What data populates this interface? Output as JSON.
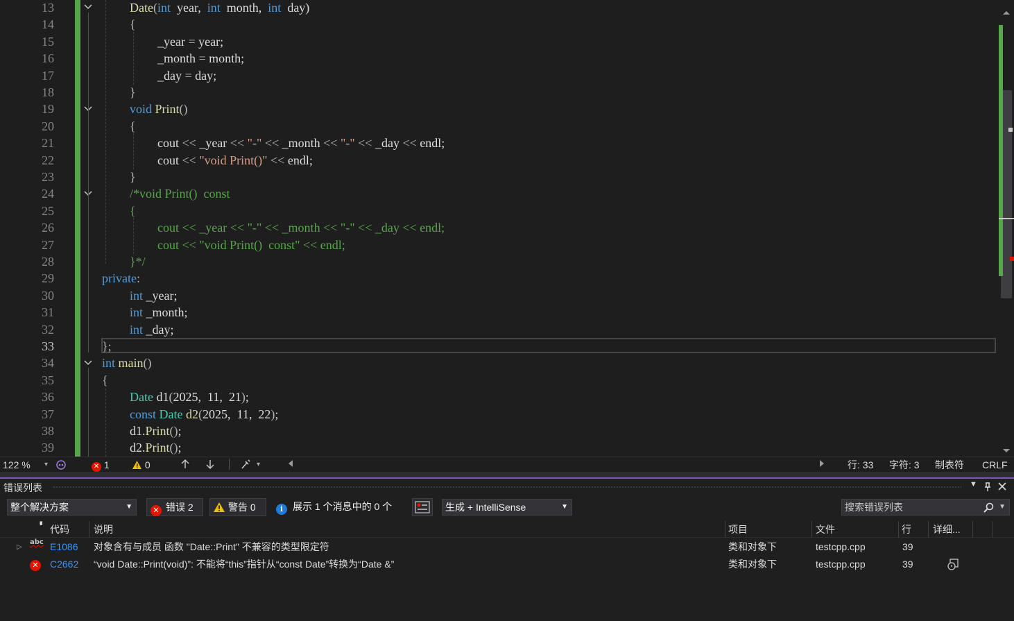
{
  "editor": {
    "line_numbers": [
      "13",
      "14",
      "15",
      "16",
      "17",
      "18",
      "19",
      "20",
      "21",
      "22",
      "23",
      "24",
      "25",
      "26",
      "27",
      "28",
      "29",
      "30",
      "31",
      "32",
      "33",
      "34",
      "35",
      "36",
      "37",
      "38",
      "39"
    ],
    "current_line": "33",
    "zoom": "122 %",
    "error_count": "1",
    "warning_count": "0",
    "position_line": "行: 33",
    "position_char": "字符: 3",
    "indent_mode": "制表符",
    "line_ending": "CRLF",
    "code_lines": [
      [
        [
          "fn",
          "Date"
        ],
        [
          "pn",
          "("
        ],
        [
          "kw",
          "int"
        ],
        [
          "",
          "  year,  "
        ],
        [
          "kw",
          "int"
        ],
        [
          "",
          "  month,  "
        ],
        [
          "kw",
          "int"
        ],
        [
          "",
          "  day)"
        ]
      ],
      [
        [
          "pn",
          "{"
        ]
      ],
      [
        [
          "",
          "_year "
        ],
        [
          "pn",
          "= "
        ],
        [
          "",
          "year;"
        ]
      ],
      [
        [
          "",
          "_month "
        ],
        [
          "pn",
          "= "
        ],
        [
          "",
          "month;"
        ]
      ],
      [
        [
          "",
          "_day "
        ],
        [
          "pn",
          "= "
        ],
        [
          "",
          "day;"
        ]
      ],
      [
        [
          "pn",
          "}"
        ]
      ],
      [
        [
          "kw",
          "void"
        ],
        [
          "",
          " "
        ],
        [
          "fn",
          "Print"
        ],
        [
          "pn",
          "()"
        ]
      ],
      [
        [
          "pn",
          "{"
        ]
      ],
      [
        [
          "",
          "cout "
        ],
        [
          "pn",
          "<< "
        ],
        [
          "",
          "_year "
        ],
        [
          "pn",
          "<< "
        ],
        [
          "st",
          "\"-\""
        ],
        [
          "",
          " "
        ],
        [
          "pn",
          "<< "
        ],
        [
          "",
          "_month "
        ],
        [
          "pn",
          "<< "
        ],
        [
          "st",
          "\"-\""
        ],
        [
          "",
          " "
        ],
        [
          "pn",
          "<< "
        ],
        [
          "",
          "_day "
        ],
        [
          "pn",
          "<< "
        ],
        [
          "",
          "endl;"
        ]
      ],
      [
        [
          "",
          "cout "
        ],
        [
          "pn",
          "<< "
        ],
        [
          "st",
          "\"void Print()\""
        ],
        [
          "",
          " "
        ],
        [
          "pn",
          "<< "
        ],
        [
          "",
          "endl;"
        ]
      ],
      [
        [
          "pn",
          "}"
        ]
      ],
      [
        [
          "cm",
          "/*void Print()  const"
        ]
      ],
      [
        [
          "cm",
          "{"
        ]
      ],
      [
        [
          "cm",
          "cout << _year << \"-\" << _month << \"-\" << _day << endl;"
        ]
      ],
      [
        [
          "cm",
          "cout << \"void Print()  const\" << endl;"
        ]
      ],
      [
        [
          "cm",
          "}*/"
        ]
      ],
      [
        [
          "kw",
          "private"
        ],
        [
          "pn",
          ":"
        ]
      ],
      [
        [
          "kw",
          "int"
        ],
        [
          "",
          " _year;"
        ]
      ],
      [
        [
          "kw",
          "int"
        ],
        [
          "",
          " _month;"
        ]
      ],
      [
        [
          "kw",
          "int"
        ],
        [
          "",
          " _day;"
        ]
      ],
      [
        [
          "pn",
          "};"
        ]
      ],
      [
        [
          "kw",
          "int"
        ],
        [
          "",
          " "
        ],
        [
          "fn",
          "main"
        ],
        [
          "pn",
          "()"
        ]
      ],
      [
        [
          "pn",
          "{"
        ]
      ],
      [
        [
          "ty",
          "Date"
        ],
        [
          "",
          " d1"
        ],
        [
          "pn",
          "("
        ],
        [
          "",
          "2025,  11,  21"
        ],
        [
          "pn",
          ")"
        ],
        [
          "",
          ";"
        ]
      ],
      [
        [
          "kw",
          "const"
        ],
        [
          "",
          " "
        ],
        [
          "ty",
          "Date"
        ],
        [
          "",
          " "
        ],
        [
          "fn",
          "d2"
        ],
        [
          "pn",
          "("
        ],
        [
          "",
          "2025,  11,  22"
        ],
        [
          "pn",
          ")"
        ],
        [
          "",
          ";"
        ]
      ],
      [
        [
          "",
          "d1."
        ],
        [
          "fn",
          "Print"
        ],
        [
          "pn",
          "()"
        ],
        [
          "",
          ";"
        ]
      ],
      [
        [
          "",
          "d2."
        ],
        [
          "fn",
          "Print"
        ],
        [
          "pn",
          "()"
        ],
        [
          "",
          ";"
        ]
      ]
    ]
  },
  "error_list": {
    "title": "错误列表",
    "scope": "整个解决方案",
    "errors_label": "错误 2",
    "warnings_label": "警告 0",
    "messages_label": "展示 1 个消息中的 0 个",
    "source": "生成 + IntelliSense",
    "search_placeholder": "搜索错误列表",
    "columns": {
      "code": "代码",
      "desc": "说明",
      "project": "项目",
      "file": "文件",
      "line": "行",
      "detail": "详细..."
    },
    "rows": [
      {
        "code": "E1086",
        "desc": "对象含有与成员 函数 \"Date::Print\" 不兼容的类型限定符",
        "project": "类和对象下",
        "file": "testcpp.cpp",
        "line": "39"
      },
      {
        "code": "C2662",
        "desc": "“void Date::Print(void)”: 不能将“this”指针从“const Date”转换为“Date &”",
        "project": "类和对象下",
        "file": "testcpp.cpp",
        "line": "39"
      }
    ]
  },
  "colors": {
    "accent": "#7e57c2",
    "error": "#e51400",
    "change_bar": "#57a64a",
    "link": "#3794ff"
  }
}
